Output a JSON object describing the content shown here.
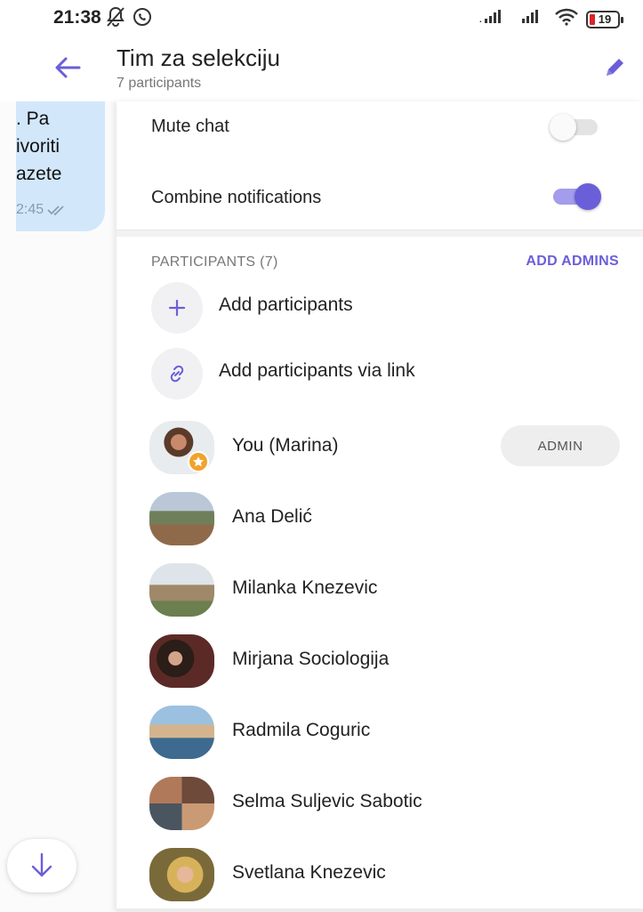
{
  "status_bar": {
    "time": "21:38",
    "left_icons": [
      "mute-alarm-icon",
      "whatsapp-icon"
    ],
    "right_icons": [
      "signal-icon",
      "signal-icon",
      "wifi-icon",
      "battery-icon"
    ],
    "battery_level": "19",
    "battery_color": "#d9242b"
  },
  "header": {
    "title": "Tim za selekciju",
    "subtitle": "7 participants",
    "accent_color": "#6b5ed9"
  },
  "chat_preview": {
    "lines": [
      ". Pa",
      "ivoriti",
      "azete"
    ],
    "time": "2:45",
    "bubble_color": "#d3e7fb"
  },
  "settings": {
    "mute_chat": {
      "label": "Mute chat",
      "on": false
    },
    "combine_notifications": {
      "label": "Combine notifications",
      "on": true
    }
  },
  "participants_section": {
    "header": "PARTICIPANTS (7)",
    "add_admins": "ADD ADMINS",
    "actions": [
      {
        "label": "Add participants",
        "icon": "plus-icon"
      },
      {
        "label": "Add participants via link",
        "icon": "link-icon"
      }
    ],
    "members": [
      {
        "name": "You (Marina)",
        "role": "ADMIN"
      },
      {
        "name": "Ana Delić"
      },
      {
        "name": "Milanka Knezevic"
      },
      {
        "name": "Mirjana Sociologija"
      },
      {
        "name": "Radmila Coguric"
      },
      {
        "name": "Selma Suljevic Sabotic"
      },
      {
        "name": "Svetlana Knezevic"
      }
    ]
  }
}
